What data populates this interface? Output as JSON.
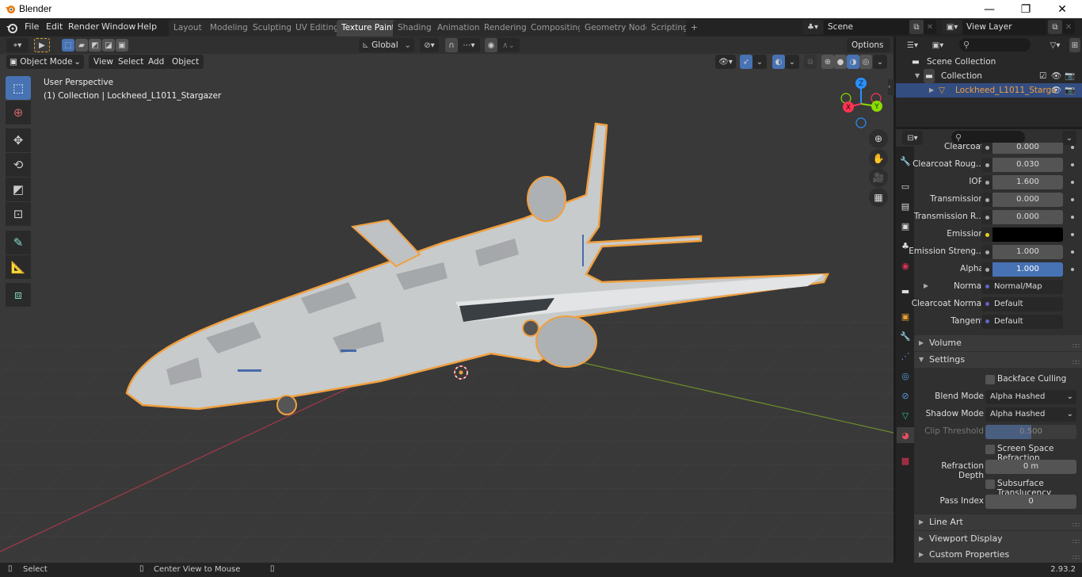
{
  "window": {
    "title": "Blender",
    "minimize": "—",
    "maximize": "❐",
    "close": "✕"
  },
  "menubar": {
    "items": [
      "File",
      "Edit",
      "Render",
      "Window",
      "Help"
    ]
  },
  "workspaces": {
    "tabs": [
      "Layout",
      "Modeling",
      "Sculpting",
      "UV Editing",
      "Texture Paint",
      "Shading",
      "Animation",
      "Rendering",
      "Compositing",
      "Geometry Nodes",
      "Scripting"
    ],
    "active": "Texture Paint",
    "add": "+"
  },
  "scene": {
    "name": "Scene",
    "view_layer": "View Layer"
  },
  "tool_header": {
    "orientation": "Global",
    "options": "Options"
  },
  "viewport_header": {
    "mode": "Object Mode",
    "menus": [
      "View",
      "Select",
      "Add",
      "Object"
    ]
  },
  "viewport": {
    "perspective_label": "User Perspective",
    "object_label": "(1) Collection | Lockheed_L1011_Stargazer",
    "gizmo": {
      "x": "X",
      "y": "Y",
      "z": "Z"
    },
    "colors": {
      "x_axis": "#ff3352",
      "y_axis": "#8bdc00",
      "z_axis": "#2890ff",
      "selection": "#f0a040"
    }
  },
  "outliner": {
    "items": [
      {
        "label": "Scene Collection"
      },
      {
        "label": "Collection"
      },
      {
        "label": "Lockheed_L1011_Starga"
      }
    ]
  },
  "properties": {
    "rows": [
      {
        "label": "Clearcoat",
        "value": "0.000"
      },
      {
        "label": "Clearcoat Roug...",
        "value": "0.030"
      },
      {
        "label": "IOR",
        "value": "1.600"
      },
      {
        "label": "Transmission",
        "value": "0.000"
      },
      {
        "label": "Transmission R...",
        "value": "0.000"
      },
      {
        "label": "Emission",
        "value": ""
      },
      {
        "label": "Emission Streng...",
        "value": "1.000"
      },
      {
        "label": "Alpha",
        "value": "1.000"
      },
      {
        "label": "Normal",
        "value": "Normal/Map"
      },
      {
        "label": "Clearcoat Normal",
        "value": "Default"
      },
      {
        "label": "Tangent",
        "value": "Default"
      }
    ],
    "panels": {
      "volume": "Volume",
      "settings": "Settings",
      "line_art": "Line Art",
      "viewport_display": "Viewport Display",
      "custom_properties": "Custom Properties"
    },
    "settings": {
      "backface_culling": "Backface Culling",
      "blend_mode_label": "Blend Mode",
      "blend_mode": "Alpha Hashed",
      "shadow_mode_label": "Shadow Mode",
      "shadow_mode": "Alpha Hashed",
      "clip_threshold_label": "Clip Threshold",
      "clip_threshold": "0.500",
      "ssr": "Screen Space Refraction",
      "refraction_depth_label": "Refraction Depth",
      "refraction_depth": "0 m",
      "subsurface": "Subsurface Translucency",
      "pass_index_label": "Pass Index",
      "pass_index": "0"
    }
  },
  "statusbar": {
    "select": "Select",
    "center": "Center View to Mouse",
    "version": "2.93.2"
  }
}
